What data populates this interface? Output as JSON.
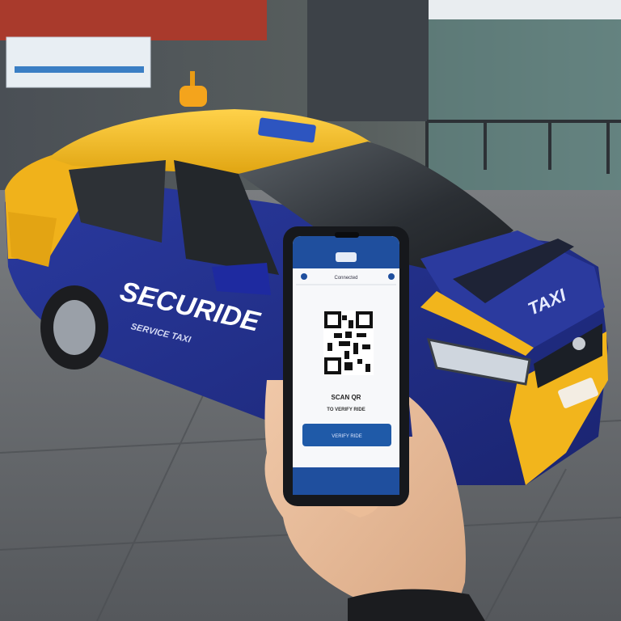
{
  "car": {
    "brand_text": "SECURIDE",
    "brand_sub": "SERVICE TAXI",
    "hood_text": "TAXI"
  },
  "phone": {
    "app_title": "Connected",
    "qr_caption_1": "SCAN QR",
    "qr_caption_2": "TO VERIFY RIDE",
    "button_label": "VERIFY RIDE"
  },
  "colors": {
    "taxi_yellow": "#f2b51c",
    "taxi_blue": "#22338f",
    "app_blue": "#1f5aa8"
  }
}
